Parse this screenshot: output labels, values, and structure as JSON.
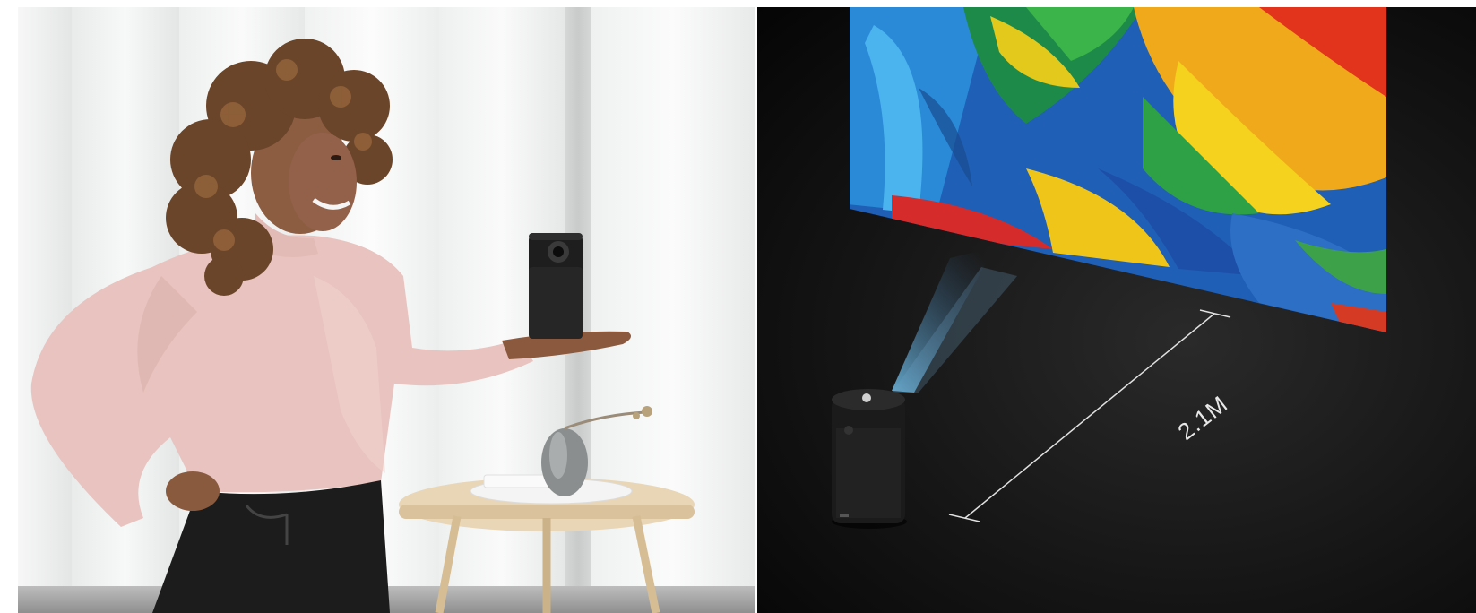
{
  "scene": {
    "left_panel": {
      "description_icon": "woman-holding-projector",
      "background": "#eeefef"
    },
    "right_panel": {
      "background": "#111111",
      "distance_label": "2.1M"
    }
  },
  "colors": {
    "sweater": "#e9c3c0",
    "pants": "#1b1b1b",
    "hair": "#6e4a2c",
    "projector": "#1f1f1f",
    "table": "#e6d4b5"
  }
}
